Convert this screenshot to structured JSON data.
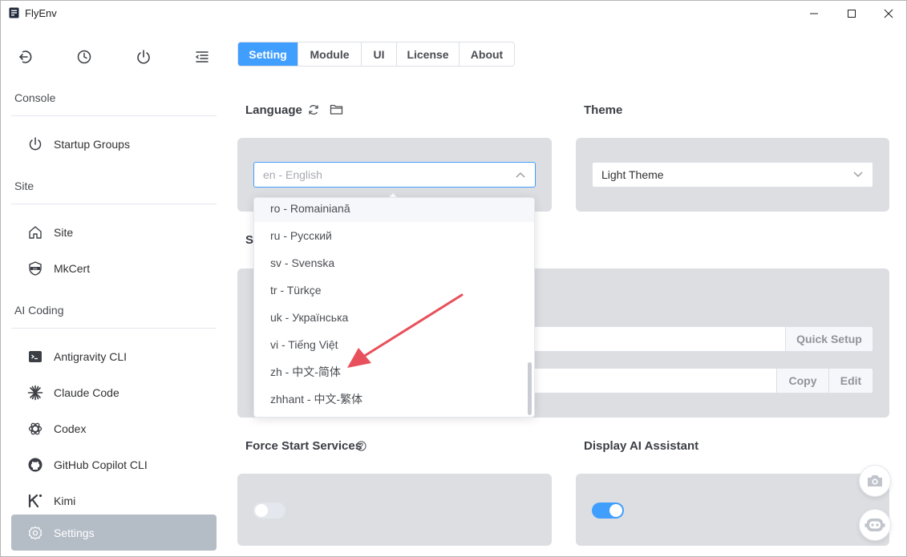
{
  "app": {
    "title": "FlyEnv"
  },
  "sidebar": {
    "sections": [
      {
        "label": "Console"
      },
      {
        "label": "Site"
      },
      {
        "label": "AI Coding"
      }
    ],
    "items": [
      {
        "label": "Startup Groups"
      },
      {
        "label": "Site"
      },
      {
        "label": "MkCert"
      },
      {
        "label": "Antigravity CLI"
      },
      {
        "label": "Claude Code"
      },
      {
        "label": "Codex"
      },
      {
        "label": "GitHub Copilot CLI"
      },
      {
        "label": "Kimi"
      },
      {
        "label": "Settings"
      }
    ]
  },
  "tabs": [
    {
      "label": "Setting",
      "active": true
    },
    {
      "label": "Module"
    },
    {
      "label": "UI"
    },
    {
      "label": "License"
    },
    {
      "label": "About"
    }
  ],
  "language": {
    "title": "Language",
    "value": "en - English"
  },
  "theme": {
    "title": "Theme",
    "value": "Light Theme"
  },
  "hidden_section": {
    "title_fragment": "S"
  },
  "row1": {
    "button": "Quick Setup"
  },
  "row2": {
    "copy": "Copy",
    "edit": "Edit"
  },
  "force_start": {
    "title": "Force Start Services",
    "enabled": false
  },
  "ai_assistant": {
    "title": "Display AI Assistant",
    "enabled": true
  },
  "dropdown": {
    "options": [
      "ro - Romainiană",
      "ru - Русский",
      "sv - Svenska",
      "tr - Türkçe",
      "uk - Українська",
      "vi - Tiếng Việt",
      "zh - 中文-简体",
      "zhhant - 中文-繁体"
    ]
  },
  "colors": {
    "accent": "#409eff",
    "card": "#dcdee2",
    "active_nav": "#b4bcc6",
    "arrow": "#e8505b"
  }
}
